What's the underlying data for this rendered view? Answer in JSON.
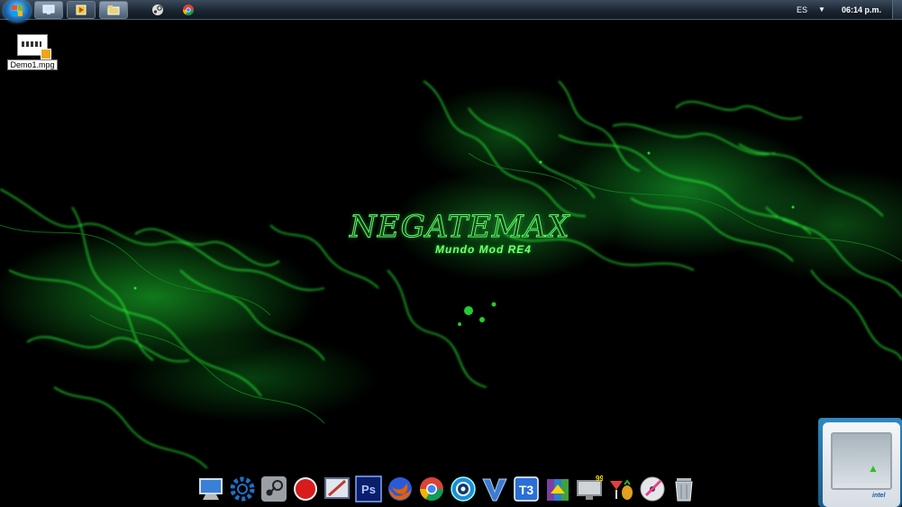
{
  "taskbar": {
    "start_icon": "windows-orb-icon",
    "pinned": [
      {
        "name": "show-desktop-window",
        "icon": "monitor-icon",
        "active": true
      },
      {
        "name": "media-player",
        "icon": "media-icon",
        "active": false
      },
      {
        "name": "explorer",
        "icon": "folder-icon",
        "active": true
      }
    ],
    "quick": [
      {
        "name": "steam",
        "icon": "steam-icon"
      },
      {
        "name": "chrome",
        "icon": "chrome-icon"
      }
    ],
    "language": "ES",
    "clock": "06:14 p.m."
  },
  "desktop": {
    "icons": [
      {
        "label": "Demo1.mpg",
        "icon": "video-file-icon"
      }
    ]
  },
  "wallpaper": {
    "title": "NEGATEMAX",
    "subtitle": "Mundo Mod RE4",
    "accent": "#2bff3a"
  },
  "dock": {
    "items": [
      {
        "name": "computer",
        "icon": "computer-icon",
        "color": "#3b7fd6"
      },
      {
        "name": "settings",
        "icon": "gear-icon",
        "color": "#1a73c8"
      },
      {
        "name": "steam",
        "icon": "steam-icon",
        "color": "#9aa0a6"
      },
      {
        "name": "record",
        "icon": "record-icon",
        "color": "#d81b1b"
      },
      {
        "name": "screen-tool",
        "icon": "screen-tool-icon",
        "color": "#5c6b8a"
      },
      {
        "name": "photoshop",
        "icon": "photoshop-icon",
        "color": "#0a1e6b"
      },
      {
        "name": "firefox",
        "icon": "firefox-icon",
        "color": "#e66000"
      },
      {
        "name": "chrome",
        "icon": "chrome-icon",
        "color": "#34a853"
      },
      {
        "name": "media-center",
        "icon": "media-center-icon",
        "color": "#1d8ed8"
      },
      {
        "name": "vegas",
        "icon": "vegas-icon",
        "color": "#3a7bd5"
      },
      {
        "name": "t3",
        "icon": "t3-icon",
        "color": "#2a6fd6"
      },
      {
        "name": "winrar",
        "icon": "archive-icon",
        "color": "#7b3fa0"
      },
      {
        "name": "display",
        "icon": "monitor-icon",
        "color": "#8a8f94"
      },
      {
        "name": "drinks",
        "icon": "cocktail-icon",
        "color": "#e0a020"
      },
      {
        "name": "disc-burner",
        "icon": "disc-icon",
        "color": "#c9c9c9"
      },
      {
        "name": "recycle-bin",
        "icon": "recycle-bin-icon",
        "color": "#b0b8c0"
      }
    ]
  },
  "gadget": {
    "icon": "cpu-meter-icon",
    "brand": "intel"
  }
}
